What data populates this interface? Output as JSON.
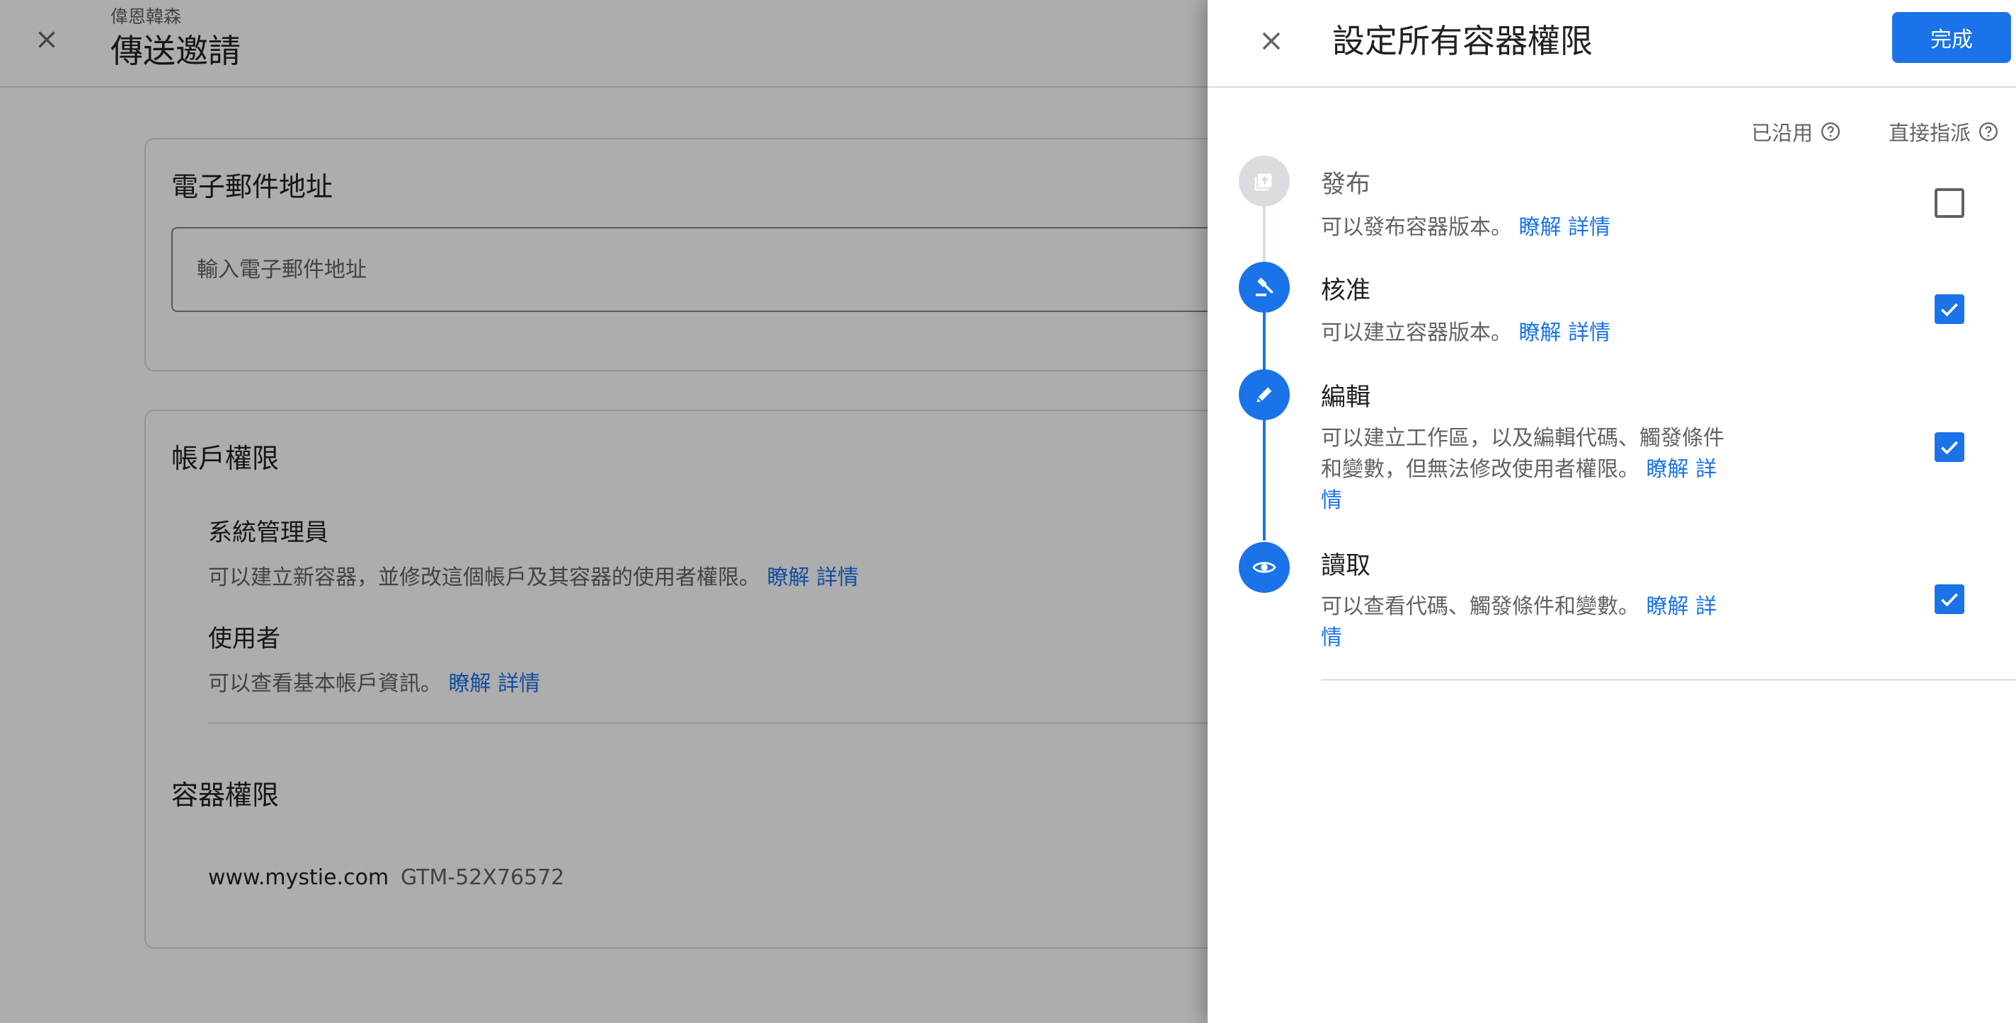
{
  "background_page": {
    "account_name": "偉恩韓森",
    "title": "傳送邀請",
    "email_card": {
      "heading": "電子郵件地址",
      "input_placeholder": "輸入電子郵件地址",
      "input_value": ""
    },
    "account_permissions": {
      "heading": "帳戶權限",
      "roles": [
        {
          "title": "系統管理員",
          "description": "可以建立新容器，並修改這個帳戶及其容器的使用者權限。",
          "link": "瞭解 詳情"
        },
        {
          "title": "使用者",
          "description": "可以查看基本帳戶資訊。",
          "link": "瞭解 詳情"
        }
      ]
    },
    "container_permissions": {
      "heading": "容器權限",
      "container_name": "www.mystie.com",
      "container_id": "GTM-52X76572"
    }
  },
  "panel": {
    "title": "設定所有容器權限",
    "done_label": "完成",
    "columns": {
      "inherited": "已沿用",
      "direct": "直接指派"
    },
    "permissions": [
      {
        "title": "發布",
        "description": "可以發布容器版本。",
        "link": "瞭解 詳情",
        "icon": "publish-icon",
        "checked": false,
        "enabled": false
      },
      {
        "title": "核准",
        "description": "可以建立容器版本。",
        "link": "瞭解 詳情",
        "icon": "gavel-icon",
        "checked": true,
        "enabled": true
      },
      {
        "title": "編輯",
        "description": "可以建立工作區，以及編輯代碼、觸發條件和變數，但無法修改使用者權限。",
        "link": "瞭解 詳情",
        "icon": "pencil-icon",
        "checked": true,
        "enabled": true
      },
      {
        "title": "讀取",
        "description": "可以查看代碼、觸發條件和變數。",
        "link": "瞭解 詳情",
        "icon": "eye-icon",
        "checked": true,
        "enabled": true
      }
    ]
  },
  "colors": {
    "accent": "#1a73e8",
    "scrim": "rgba(0,0,0,0.32)",
    "disabled_step": "#dadce0"
  }
}
